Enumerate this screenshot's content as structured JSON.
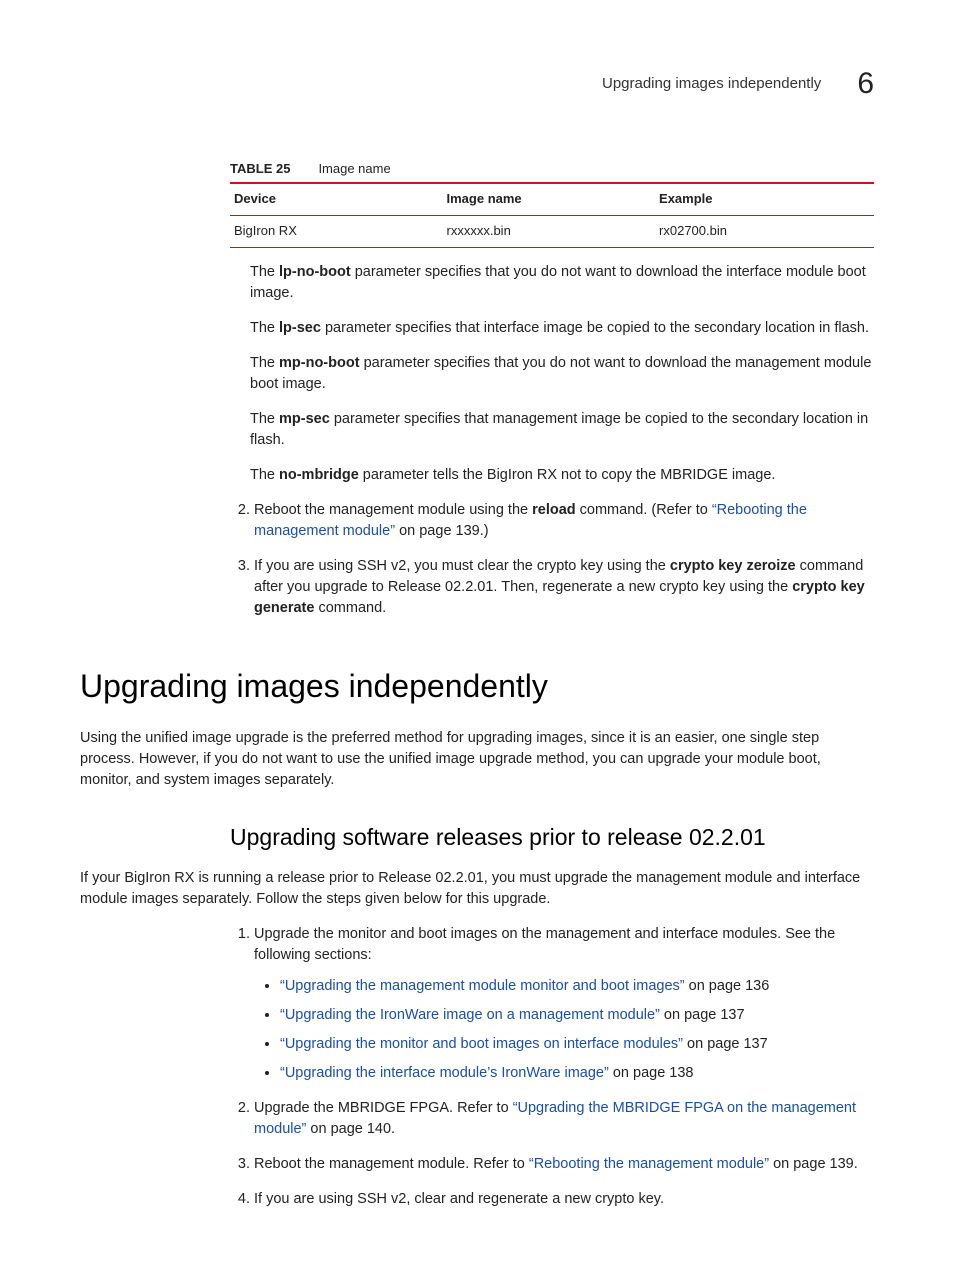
{
  "header": {
    "running_title": "Upgrading images independently",
    "chapter": "6"
  },
  "table": {
    "label_prefix": "TABLE 25",
    "label_title": "Image name",
    "headers": {
      "c1": "Device",
      "c2": "Image name",
      "c3": "Example"
    },
    "row": {
      "c1": "BigIron RX",
      "c2": "rxxxxxx.bin",
      "c3": "rx02700.bin"
    }
  },
  "params": {
    "lp_no_boot_pre": "The ",
    "lp_no_boot_b": "lp-no-boot",
    "lp_no_boot_post": " parameter specifies that you do not want to download the interface module boot image.",
    "lp_sec_pre": "The ",
    "lp_sec_b": "lp-sec",
    "lp_sec_post": " parameter specifies that interface image be copied to the secondary location in flash.",
    "mp_no_boot_pre": "The ",
    "mp_no_boot_b": "mp-no-boot",
    "mp_no_boot_post": " parameter specifies that you do not want to download the management module boot image.",
    "mp_sec_pre": "The ",
    "mp_sec_b": "mp-sec",
    "mp_sec_post": " parameter specifies that management image be copied to the secondary location in flash.",
    "no_mbridge_pre": "The ",
    "no_mbridge_b": "no-mbridge",
    "no_mbridge_post": " parameter tells the BigIron RX not to copy the MBRIDGE image."
  },
  "steps_a": {
    "s2_pre": "Reboot the management module using the ",
    "s2_b": "reload",
    "s2_mid": " command. (Refer to ",
    "s2_link": "“Rebooting the management module”",
    "s2_post": " on page 139.)",
    "s3_pre": "If you are using SSH v2, you must clear the crypto key using the ",
    "s3_b1": "crypto key zeroize",
    "s3_mid": " command after you upgrade to Release 02.2.01. Then, regenerate a new crypto key using the ",
    "s3_b2": "crypto key generate",
    "s3_post": " command."
  },
  "section": {
    "title": "Upgrading images independently",
    "intro": "Using the unified image upgrade is the preferred method for upgrading images, since it is an easier, one single step process. However, if you do not want to use the unified image upgrade method, you can upgrade your module boot, monitor, and system images separately."
  },
  "subsection": {
    "title": "Upgrading software releases prior to release 02.2.01",
    "intro": "If your BigIron RX is running a release prior to Release 02.2.01, you must upgrade the management module and interface module images separately. Follow the steps given below for this upgrade.",
    "s1_text": "Upgrade the monitor and boot images on the management and interface modules. See the following sections:",
    "bullets": {
      "b1_link": "“Upgrading the management module monitor and boot images”",
      "b1_post": " on page 136",
      "b2_link": "“Upgrading the IronWare image on a management module”",
      "b2_post": " on page 137",
      "b3_link": "“Upgrading the monitor and boot images on interface modules”",
      "b3_post": " on page 137",
      "b4_link": "“Upgrading the interface module’s IronWare image”",
      "b4_post": " on page 138"
    },
    "s2_pre": "Upgrade the MBRIDGE FPGA. Refer to ",
    "s2_link": "“Upgrading the MBRIDGE FPGA on the management module”",
    "s2_post": " on page 140.",
    "s3_pre": "Reboot the management module. Refer to ",
    "s3_link": "“Rebooting the management module”",
    "s3_post": " on page 139.",
    "s4": "If you are using SSH v2, clear and regenerate a new crypto key."
  }
}
